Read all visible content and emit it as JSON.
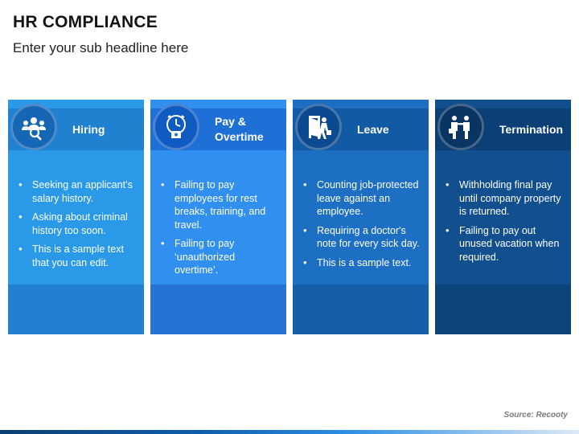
{
  "title": "HR COMPLIANCE",
  "subtitle": "Enter your sub headline here",
  "source": "Source: Recooty",
  "cards": [
    {
      "label": "Hiring",
      "icon": "team-search-icon",
      "colors": {
        "card": "#2a9ae8",
        "header": "#1f81cf",
        "circle": "#1566b5",
        "base": "#2180d2"
      },
      "items": [
        "Seeking an applicant’s salary history.",
        "Asking about criminal history too soon.",
        "This is a sample text that you can edit."
      ]
    },
    {
      "label": "Pay &\nOvertime",
      "icon": "overtime-clock-icon",
      "colors": {
        "card": "#318ff0",
        "header": "#1e6fd6",
        "circle": "#0f5bc1",
        "base": "#2773d3"
      },
      "items": [
        "Failing to pay employees for rest breaks, training, and travel.",
        "Failing to pay ‘unauthorized overtime’."
      ]
    },
    {
      "label": "Leave",
      "icon": "exit-door-icon",
      "colors": {
        "card": "#1d6fc3",
        "header": "#135aa5",
        "circle": "#0b4a90",
        "base": "#175ea9"
      },
      "items": [
        "Counting job-protected leave against an employee.",
        "Requiring a doctor's note for every sick day.",
        "This is a sample text."
      ]
    },
    {
      "label": "Termination",
      "icon": "dismissal-icon",
      "colors": {
        "card": "#114f8f",
        "header": "#0b3f76",
        "circle": "#083562",
        "base": "#0d4479"
      },
      "items": [
        "Withholding final pay until company property is returned.",
        "Failing to pay out unused vacation when required."
      ]
    }
  ]
}
